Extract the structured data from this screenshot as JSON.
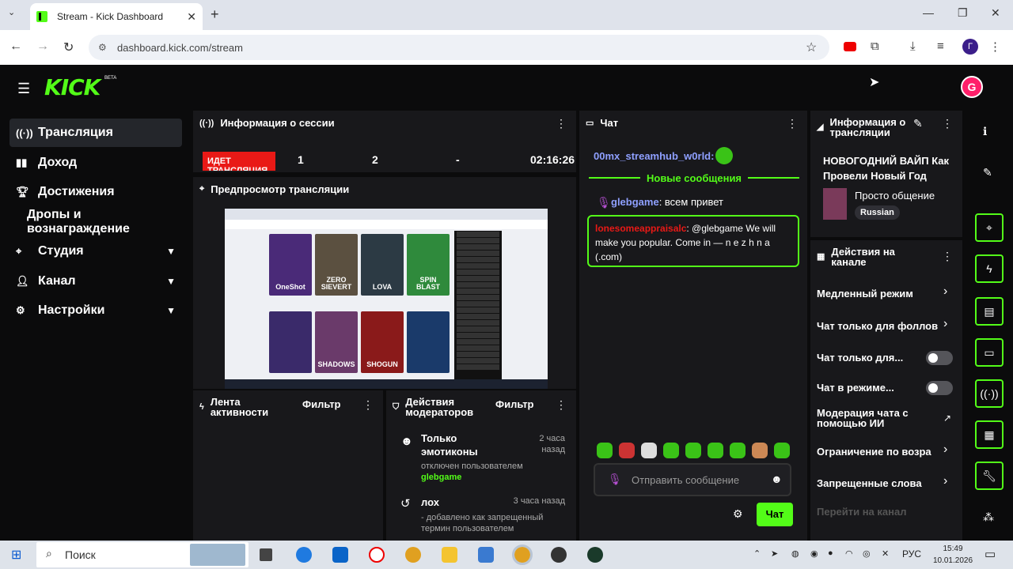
{
  "browser": {
    "tab_title": "Stream - Kick Dashboard",
    "url": "dashboard.kick.com/stream"
  },
  "header": {
    "logo": "KICK",
    "beta": "BETA",
    "avatar_letter": "G"
  },
  "sidebar": {
    "items": [
      {
        "label": "Трансляция",
        "icon": "broadcast-icon"
      },
      {
        "label": "Доход",
        "icon": "chart-icon"
      },
      {
        "label": "Достижения",
        "icon": "trophy-icon"
      },
      {
        "label": "Дропы и вознаграждение",
        "icon": ""
      },
      {
        "label": "Студия",
        "icon": "studio-icon"
      },
      {
        "label": "Канал",
        "icon": "user-icon"
      },
      {
        "label": "Настройки",
        "icon": "gear-icon"
      }
    ]
  },
  "session": {
    "title": "Информация о сессии",
    "live_badge": "ИДЕТ ТРАНСЛЯЦИЯ",
    "stat1": "1",
    "stat2": "2",
    "stat3": "-",
    "duration": "02:16:26"
  },
  "preview": {
    "title": "Предпросмотр трансляции",
    "games": [
      "OneShot",
      "ZERO SIEVERT",
      "LOVA",
      "SPIN BLAST",
      "",
      "SHADOWS",
      "SHOGUN",
      ""
    ]
  },
  "activity": {
    "title": "Лента активности",
    "filter": "Фильтр"
  },
  "mod_actions": {
    "title": "Действия модераторов",
    "filter": "Фильтр",
    "entries": [
      {
        "action": "Только эмотиконы",
        "time": "2 часа назад",
        "detail": "отключен пользователем",
        "user": "glebgame"
      },
      {
        "action": "лох",
        "time": "3 часа назад",
        "detail": "- добавлено как запрещенный термин пользователем",
        "user": ""
      }
    ]
  },
  "chat": {
    "title": "Чат",
    "msg1_user": "00mx_streamhub_w0rld:",
    "new_messages": "Новые сообщения",
    "msg2_user": "glebgame",
    "msg2_text": ": всем привет",
    "msg3_user": "lonesomeappraisalc",
    "msg3_text": ": @glebgame We will make you popular. Come in — n e z h n a (.com)",
    "input_placeholder": "Отправить сообщение",
    "send": "Чат"
  },
  "stream_info": {
    "title": "Информация о трансляции",
    "stream_title": "НОВОГОДНИЙ ВАЙП Как Провели Новый Год",
    "category": "Просто общение",
    "language": "Russian"
  },
  "channel_actions": {
    "title": "Действия на канале",
    "items": [
      {
        "label": "Медленный режим",
        "kind": "chevron"
      },
      {
        "label": "Чат только для фоллов",
        "kind": "chevron"
      },
      {
        "label": "Чат только для...",
        "kind": "toggle",
        "on": false
      },
      {
        "label": "Чат в режиме...",
        "kind": "toggle",
        "on": false
      },
      {
        "label": "Модерация чата с помощью ИИ",
        "kind": "external"
      },
      {
        "label": "Ограничение по возра",
        "kind": "chevron"
      },
      {
        "label": "Запрещенные слова",
        "kind": "chevron"
      },
      {
        "label": "Перейти на канал",
        "kind": "disabled"
      }
    ]
  },
  "taskbar": {
    "search": "Поиск",
    "lang": "РУС",
    "time": "15:49",
    "date": "10.01.2026"
  },
  "colors": {
    "accent": "#53fc18",
    "panel": "#18181b",
    "live": "#e91916"
  }
}
